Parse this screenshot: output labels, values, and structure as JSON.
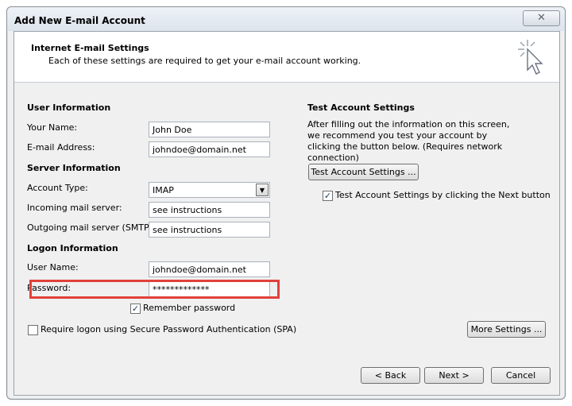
{
  "window": {
    "title": "Add New E-mail Account",
    "close_glyph": "✕"
  },
  "header": {
    "title": "Internet E-mail Settings",
    "subtitle": "Each of these settings are required to get your e-mail account working.",
    "icon": "cursor-sparkle-icon"
  },
  "user_info": {
    "heading": "User Information",
    "name_label": "Your Name:",
    "name_value": "John Doe",
    "email_label": "E-mail Address:",
    "email_value": "johndoe@domain.net"
  },
  "server_info": {
    "heading": "Server Information",
    "account_type_label": "Account Type:",
    "account_type_value": "IMAP",
    "incoming_label": "Incoming mail server:",
    "incoming_value": "see instructions",
    "outgoing_label": "Outgoing mail server (SMTP):",
    "outgoing_value": "see instructions"
  },
  "logon_info": {
    "heading": "Logon Information",
    "username_label": "User Name:",
    "username_value": "johndoe@domain.net",
    "password_label": "Password:",
    "password_value": "*************",
    "remember_label": "Remember password",
    "remember_checked": true,
    "spa_label": "Require logon using Secure Password Authentication (SPA)",
    "spa_checked": false
  },
  "test_settings": {
    "heading": "Test Account Settings",
    "description": "After filling out the information on this screen, we recommend you test your account by clicking the button below. (Requires network connection)",
    "test_button": "Test Account Settings ...",
    "next_test_label": "Test Account Settings by clicking the Next button",
    "next_test_checked": true
  },
  "buttons": {
    "more_settings": "More Settings ...",
    "back": "< Back",
    "next": "Next >",
    "cancel": "Cancel"
  },
  "colors": {
    "highlight": "#e0413a",
    "window_bg": "#f0f0f0"
  }
}
